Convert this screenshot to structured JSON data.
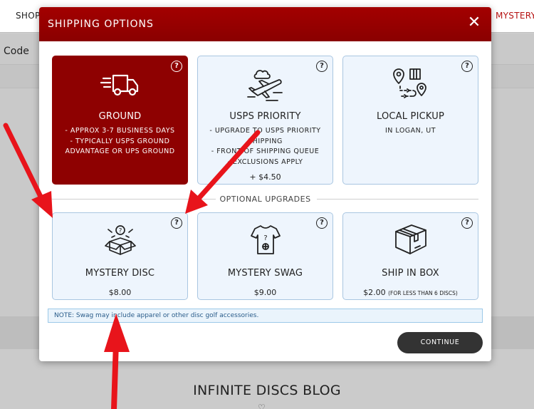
{
  "background": {
    "nav_left": "SHOP",
    "nav_right": "MYSTERY CHA",
    "code_label": "Code",
    "blog_title": "INFINITE DISCS BLOG"
  },
  "modal": {
    "title": "SHIPPING OPTIONS",
    "close": "✕",
    "shipping_options": [
      {
        "name": "GROUND",
        "details": [
          "- APPROX 3-7 BUSINESS DAYS",
          "- TYPICALLY USPS GROUND",
          "ADVANTAGE OR UPS GROUND"
        ],
        "price": "",
        "selected": true,
        "icon": "truck-icon"
      },
      {
        "name": "USPS PRIORITY",
        "details": [
          "- UPGRADE TO USPS PRIORITY",
          "SHIPPING",
          "- FRONT OF SHIPPING QUEUE",
          "- EXCLUSIONS APPLY"
        ],
        "price": "+ $4.50",
        "selected": false,
        "icon": "airplane-icon"
      },
      {
        "name": "LOCAL PICKUP",
        "details": [
          "IN LOGAN, UT"
        ],
        "price": "",
        "selected": false,
        "icon": "map-route-icon"
      }
    ],
    "divider_label": "OPTIONAL UPGRADES",
    "upgrades": [
      {
        "name": "MYSTERY DISC",
        "price": "$8.00",
        "price_note": "",
        "icon": "mystery-box-icon"
      },
      {
        "name": "MYSTERY SWAG",
        "price": "$9.00",
        "price_note": "",
        "icon": "mystery-shirt-icon"
      },
      {
        "name": "SHIP IN BOX",
        "price": "$2.00",
        "price_note": "(FOR LESS THAN 6 DISCS)",
        "icon": "box-icon"
      }
    ],
    "help_glyph": "?",
    "note": "NOTE: Swag may include apparel or other disc golf accessories.",
    "continue_label": "CONTINUE"
  },
  "colors": {
    "header_red": "#8e0101",
    "card_bg": "#eef5fd",
    "card_border": "#a9c6e1",
    "button_dark": "#333333",
    "arrow_red": "#e8141b"
  }
}
